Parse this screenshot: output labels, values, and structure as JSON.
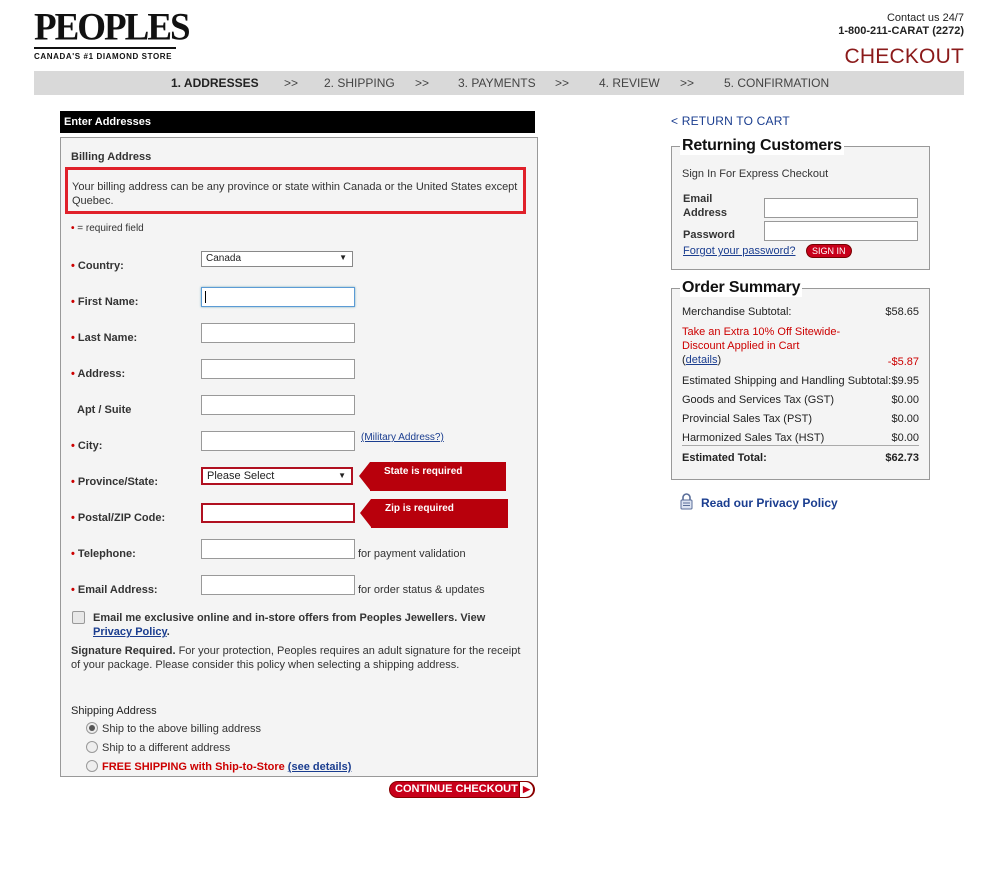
{
  "brand": {
    "logo_text": "PEOPLES",
    "tagline": "CANADA'S #1 DIAMOND STORE"
  },
  "contact": {
    "line1": "Contact us 24/7",
    "phone": "1-800-211-CARAT (2272)"
  },
  "page_title": "CHECKOUT",
  "steps": [
    {
      "label": "1. ADDRESSES"
    },
    {
      "label": ">>"
    },
    {
      "label": "2. SHIPPING"
    },
    {
      "label": ">>"
    },
    {
      "label": "3. PAYMENTS"
    },
    {
      "label": ">>"
    },
    {
      "label": "4. REVIEW"
    },
    {
      "label": ">>"
    },
    {
      "label": "5. CONFIRMATION"
    }
  ],
  "form": {
    "panel_title": "Enter Addresses",
    "billing_heading": "Billing Address",
    "notice": "Your billing address can be any province or state within Canada or the United States except Quebec.",
    "required_note": "= required field",
    "fields": {
      "country": {
        "label": "Country:",
        "value": "Canada"
      },
      "first_name": {
        "label": "First Name:",
        "value": ""
      },
      "last_name": {
        "label": "Last Name:",
        "value": ""
      },
      "address": {
        "label": "Address:",
        "value": ""
      },
      "apt": {
        "label": "Apt / Suite",
        "value": ""
      },
      "city": {
        "label": "City:",
        "value": "",
        "link": "(Military Address?)"
      },
      "province": {
        "label": "Province/State:",
        "value": "Please Select",
        "error": "State is required"
      },
      "postal": {
        "label": "Postal/ZIP Code:",
        "value": "",
        "error": "Zip is required"
      },
      "telephone": {
        "label": "Telephone:",
        "value": "",
        "hint": "for payment validation"
      },
      "email": {
        "label": "Email Address:",
        "value": "",
        "hint": "for order status & updates"
      }
    },
    "optin_text": "Email me exclusive online and in-store offers from Peoples Jewellers. View",
    "optin_link": "Privacy Policy",
    "optin_period": ".",
    "signature_bold": "Signature Required.",
    "signature_text": " For your protection, Peoples requires an adult signature for the receipt of your package. Please consider this policy when selecting a shipping address.",
    "shipping_heading": "Shipping Address",
    "shipping_options": {
      "same": "Ship to the above billing address",
      "different": "Ship to a different address",
      "store": "FREE SHIPPING with Ship-to-Store",
      "store_link": "(see details)"
    },
    "continue_label": "CONTINUE CHECKOUT"
  },
  "sidebar": {
    "return_link": "< RETURN TO CART",
    "returning": {
      "title": "Returning Customers",
      "subtitle": "Sign In For Express Checkout",
      "email_label_1": "Email",
      "email_label_2": "Address",
      "password_label": "Password",
      "forgot_link": "Forgot your password?",
      "signin_label": "SIGN IN"
    },
    "order_summary": {
      "title": "Order Summary",
      "merch_label": "Merchandise Subtotal:",
      "merch_value": "$58.65",
      "promo_line1": "Take an Extra 10% Off Sitewide-",
      "promo_line2": "Discount Applied in Cart",
      "promo_details": "details",
      "promo_value": "-$5.87",
      "shipping_label": "Estimated Shipping and Handling Subtotal:",
      "shipping_value": "$9.95",
      "gst_label": "Goods and Services Tax (GST)",
      "gst_value": "$0.00",
      "pst_label": "Provincial Sales Tax (PST)",
      "pst_value": "$0.00",
      "hst_label": "Harmonized Sales Tax (HST)",
      "hst_value": "$0.00",
      "total_label": "Estimated Total:",
      "total_value": "$62.73"
    },
    "privacy_link": "Read our Privacy Policy"
  },
  "colors": {
    "accent_red": "#c8001a",
    "title_red": "#8b1a1a",
    "link_blue": "#1a3d8f",
    "error_red": "#b8000c"
  }
}
